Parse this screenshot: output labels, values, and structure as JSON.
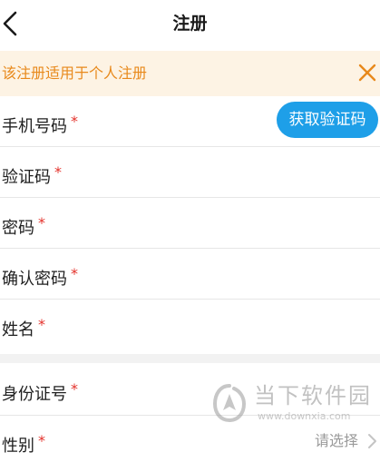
{
  "header": {
    "title": "注册"
  },
  "notice": {
    "text": "该注册适用于个人注册"
  },
  "form": {
    "required_mark": "*",
    "phone": {
      "label": "手机号码",
      "value": ""
    },
    "get_code_button": "获取验证码",
    "code": {
      "label": "验证码",
      "value": ""
    },
    "password": {
      "label": "密码",
      "value": ""
    },
    "confirm_password": {
      "label": "确认密码",
      "value": ""
    },
    "name": {
      "label": "姓名",
      "value": ""
    },
    "id_number": {
      "label": "身份证号",
      "value": ""
    },
    "gender": {
      "label": "性别",
      "value": "请选择"
    }
  },
  "watermark": {
    "title": "当下软件园",
    "url": "www.downxia.com"
  },
  "colors": {
    "accent_blue": "#1e9fe8",
    "notice_orange": "#e8891b",
    "notice_bg": "#fdf3e4",
    "required_red": "#e4322b"
  }
}
